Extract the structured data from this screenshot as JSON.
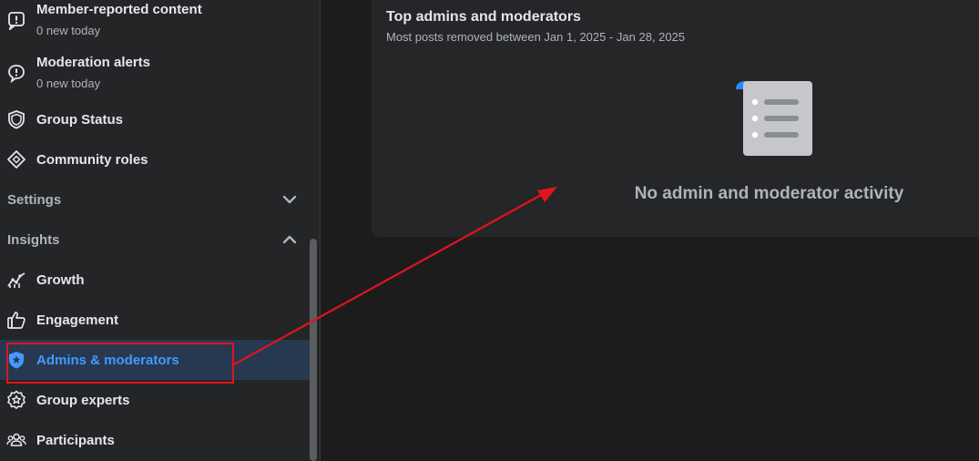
{
  "sidebar": {
    "items": [
      {
        "id": "member-reported",
        "label": "Member-reported content",
        "sub": "0 new today",
        "icon": "report-icon"
      },
      {
        "id": "moderation-alerts",
        "label": "Moderation alerts",
        "sub": "0 new today",
        "icon": "alert-bubble-icon"
      },
      {
        "id": "group-status",
        "label": "Group Status",
        "icon": "shield-icon"
      },
      {
        "id": "community-roles",
        "label": "Community roles",
        "icon": "diamond-icon"
      }
    ],
    "settings": {
      "label": "Settings",
      "icon": "chevron-down-icon"
    },
    "insights": {
      "label": "Insights",
      "icon": "chevron-up-icon"
    },
    "insights_items": [
      {
        "id": "growth",
        "label": "Growth",
        "icon": "growth-chart-icon"
      },
      {
        "id": "engagement",
        "label": "Engagement",
        "icon": "thumbs-up-icon"
      },
      {
        "id": "admins-moderators",
        "label": "Admins & moderators",
        "icon": "shield-star-icon",
        "active": true
      },
      {
        "id": "group-experts",
        "label": "Group experts",
        "icon": "badge-star-icon"
      },
      {
        "id": "participants",
        "label": "Participants",
        "icon": "people-icon"
      }
    ]
  },
  "card": {
    "title": "Top admins and moderators",
    "subtitle": "Most posts removed between Jan 1, 2025 - Jan 28, 2025",
    "empty_icon": "document-list-icon",
    "empty_text": "No admin and moderator activity"
  },
  "colors": {
    "accent": "#4599ff",
    "annotation": "#e0141d",
    "active_bg": "#263951"
  }
}
